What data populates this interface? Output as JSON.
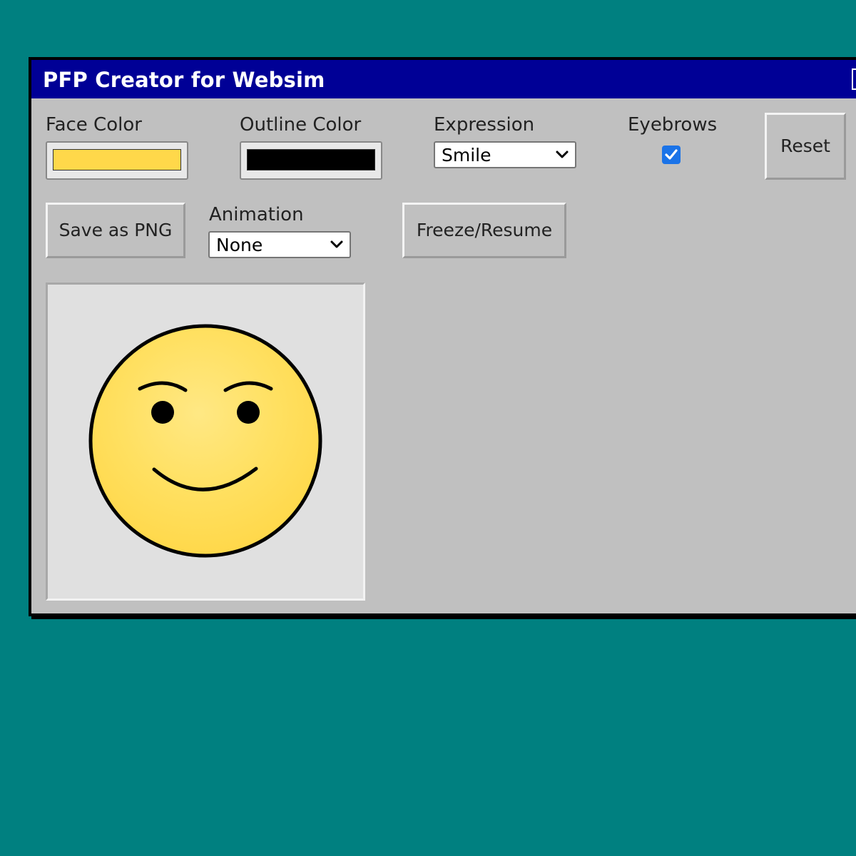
{
  "window": {
    "title": "PFP Creator for Websim"
  },
  "controls": {
    "face_color": {
      "label": "Face Color",
      "value": "#ffd84a"
    },
    "outline_color": {
      "label": "Outline Color",
      "value": "#000000"
    },
    "expression": {
      "label": "Expression",
      "selected": "Smile"
    },
    "eyebrows": {
      "label": "Eyebrows",
      "checked": true
    },
    "reset_label": "Reset",
    "save_label": "Save as PNG",
    "animation": {
      "label": "Animation",
      "selected": "None"
    },
    "freeze_label": "Freeze/Resume"
  },
  "icons": {
    "select_arrow": "chevron-down-icon",
    "checkbox_check": "checkmark-icon"
  },
  "colors": {
    "desktop": "#008080",
    "titlebar": "#000096",
    "window_bg": "#c0c0c0",
    "checkbox_accent": "#1a73e8"
  }
}
